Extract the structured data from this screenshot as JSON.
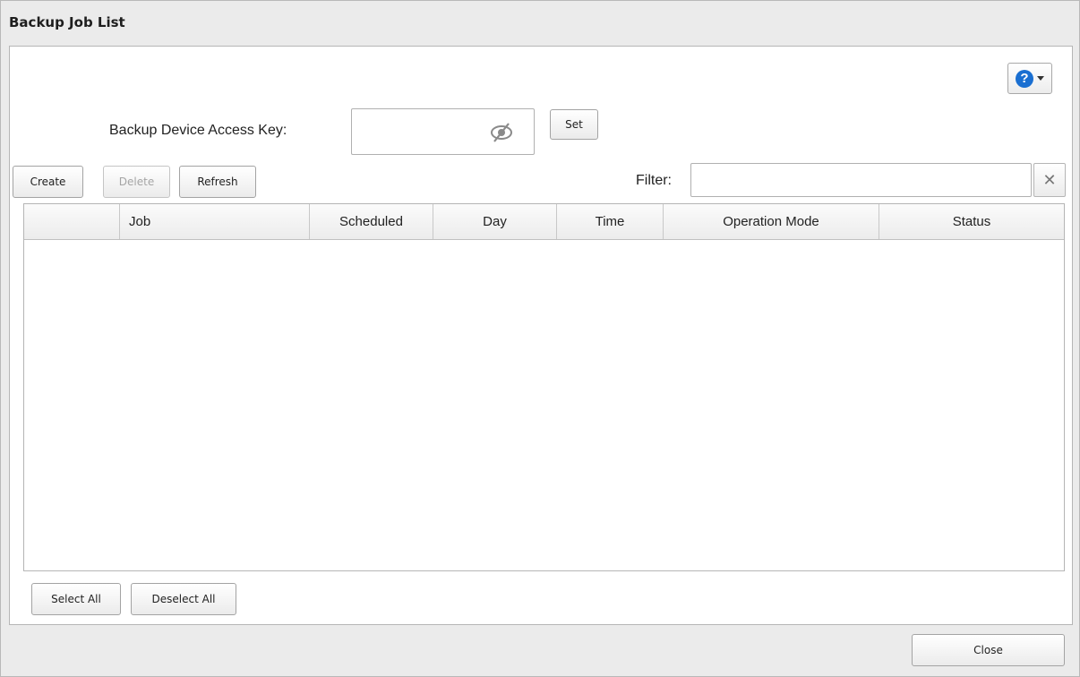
{
  "window": {
    "title": "Backup Job List"
  },
  "help": {
    "icon": "question-circle-icon",
    "symbol": "?",
    "color": "#1a6fd1"
  },
  "access_key": {
    "label": "Backup Device Access Key:",
    "value": "",
    "visibility_icon": "eye-slash-icon",
    "set_label": "Set"
  },
  "toolbar": {
    "create_label": "Create",
    "delete_label": "Delete",
    "refresh_label": "Refresh",
    "filter_label": "Filter:",
    "filter_value": "",
    "clear_symbol": "✕"
  },
  "table": {
    "columns": [
      "",
      "Job",
      "Scheduled",
      "Day",
      "Time",
      "Operation Mode",
      "Status"
    ],
    "rows": []
  },
  "selection": {
    "select_all_label": "Select All",
    "deselect_all_label": "Deselect All"
  },
  "footer": {
    "close_label": "Close"
  }
}
